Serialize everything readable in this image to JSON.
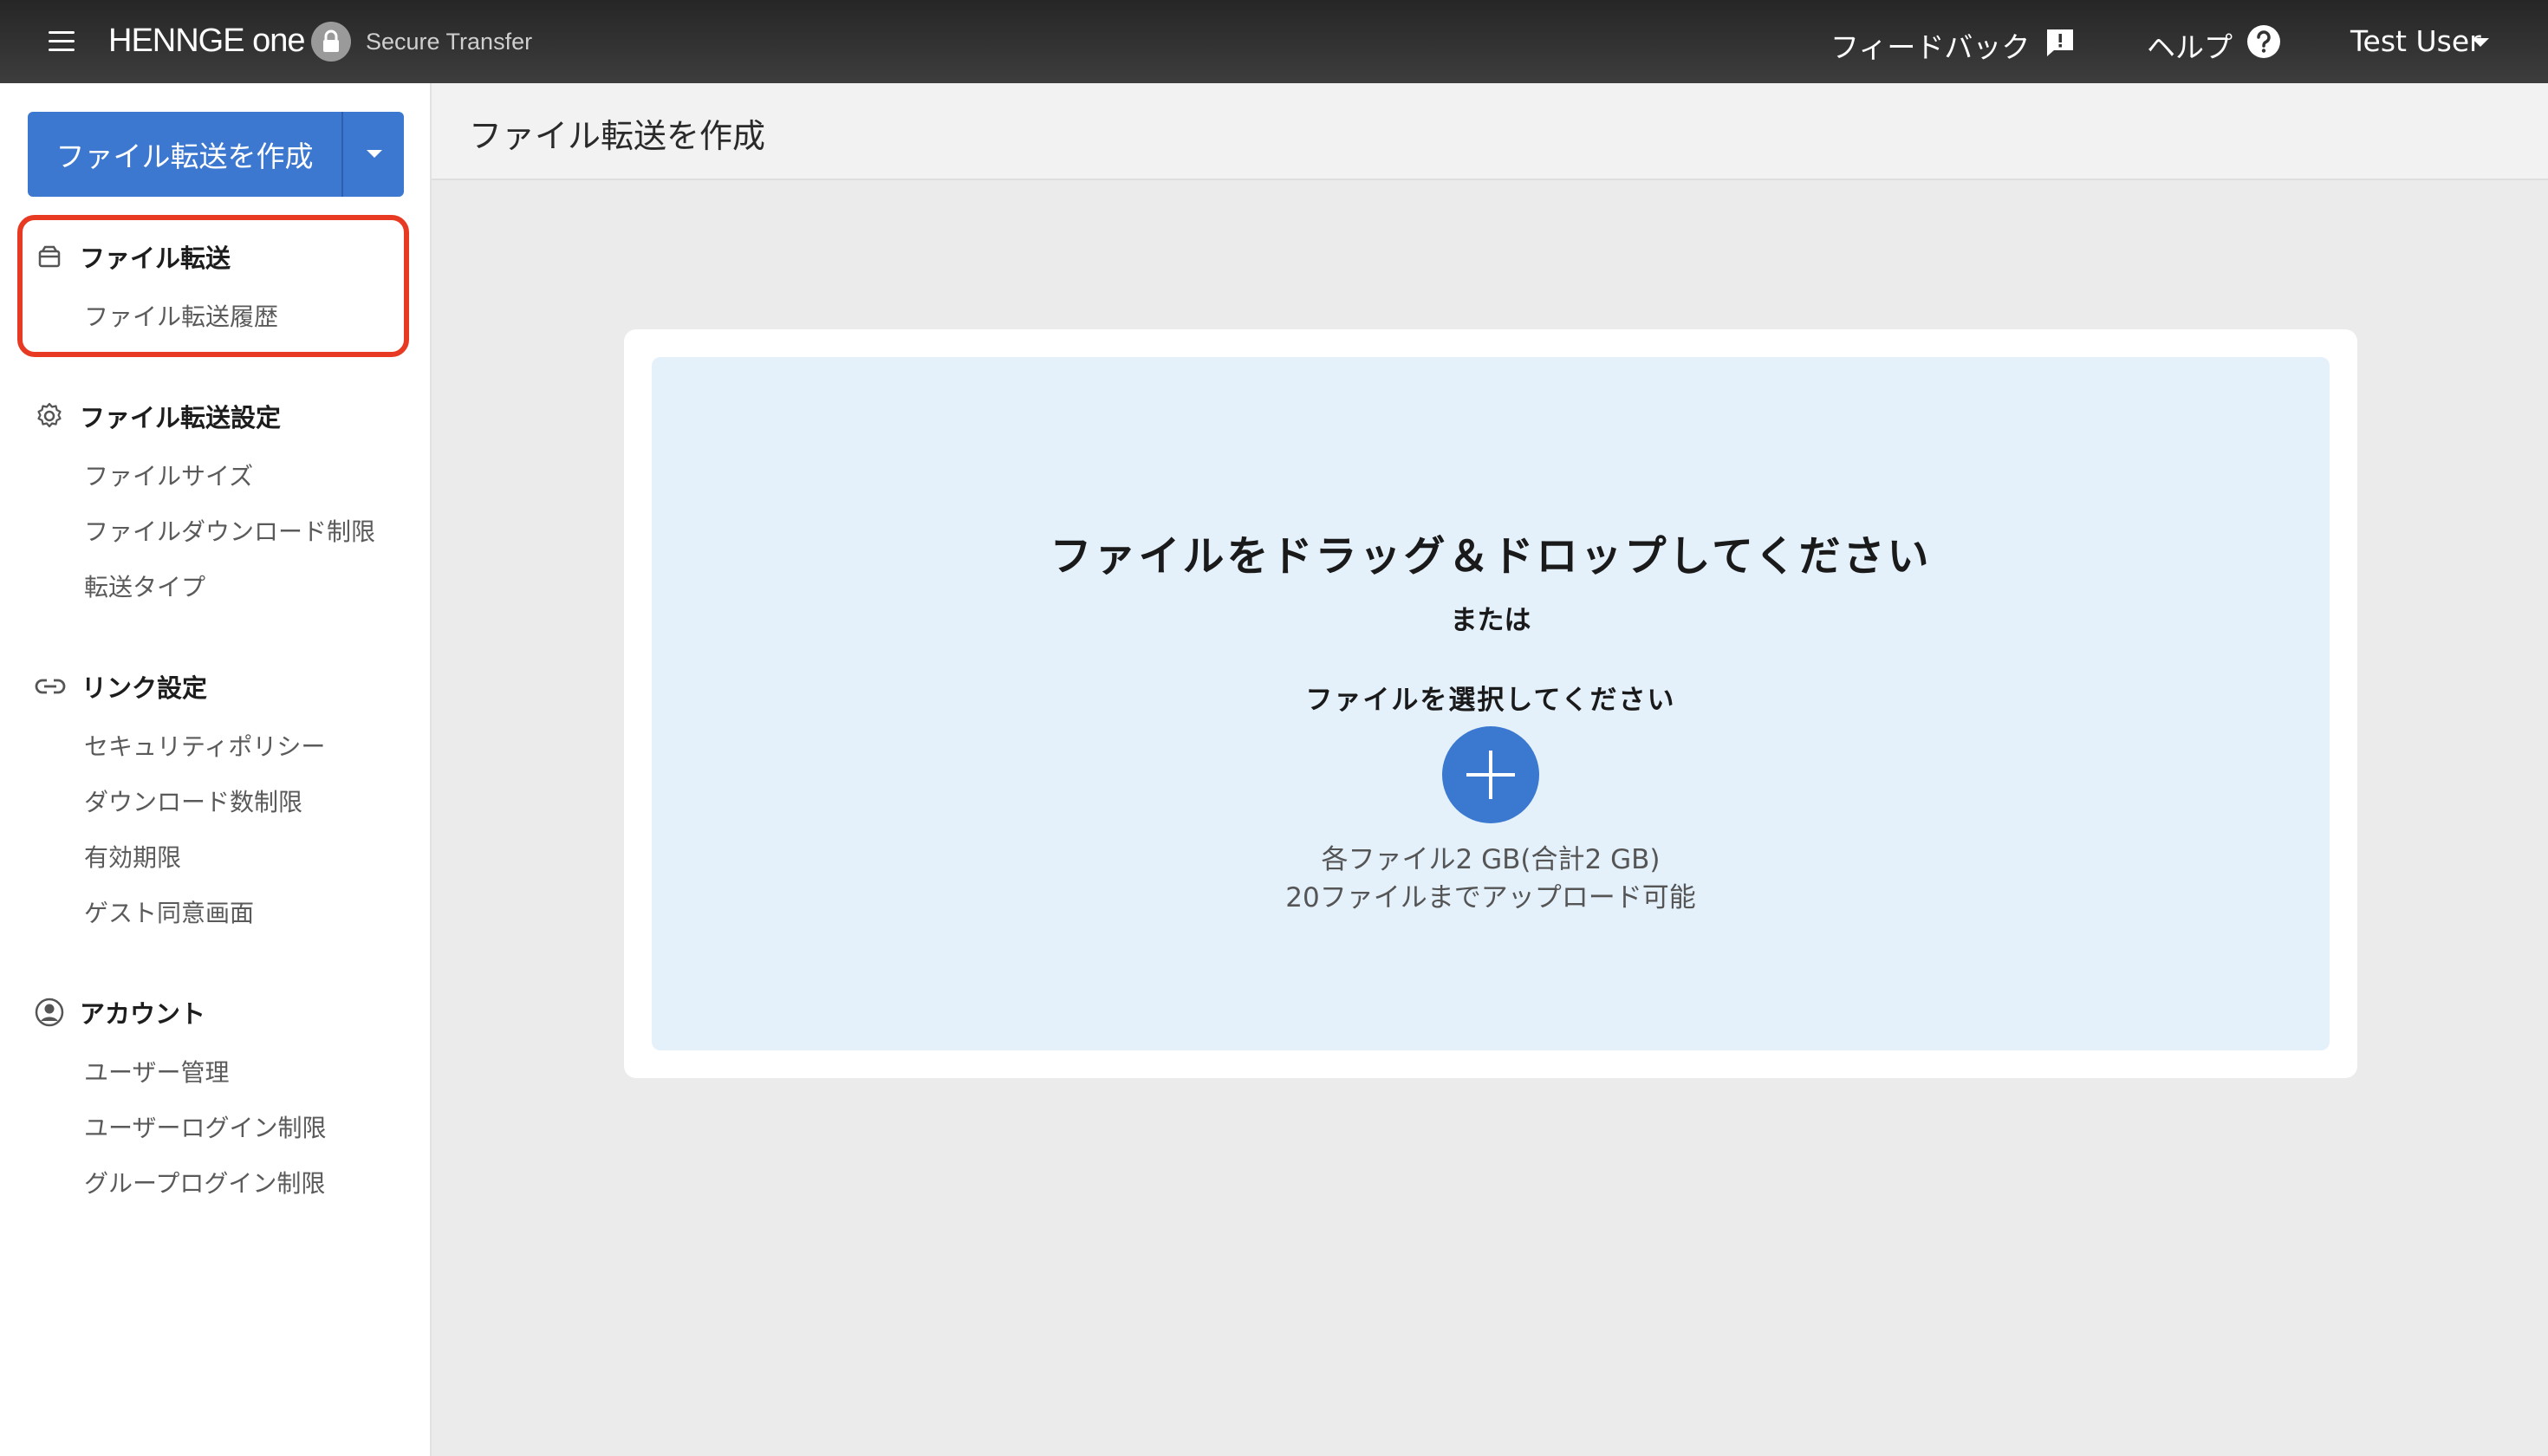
{
  "header": {
    "brand": "HENNGE one",
    "product": "Secure Transfer",
    "feedback_label": "フィードバック",
    "help_label": "ヘルプ",
    "user_name": "Test User"
  },
  "sidebar": {
    "create_button_label": "ファイル転送を作成",
    "sections": [
      {
        "title": "ファイル転送",
        "icon": "archive-box-icon",
        "items": [
          "ファイル転送履歴"
        ]
      },
      {
        "title": "ファイル転送設定",
        "icon": "gear-icon",
        "items": [
          "ファイルサイズ",
          "ファイルダウンロード制限",
          "転送タイプ"
        ]
      },
      {
        "title": "リンク設定",
        "icon": "link-icon",
        "items": [
          "セキュリティポリシー",
          "ダウンロード数制限",
          "有効期限",
          "ゲスト同意画面"
        ]
      },
      {
        "title": "アカウント",
        "icon": "account-circle-icon",
        "items": [
          "ユーザー管理",
          "ユーザーログイン制限",
          "グループログイン制限"
        ]
      }
    ]
  },
  "main": {
    "page_title": "ファイル転送を作成",
    "dropzone": {
      "title": "ファイルをドラッグ＆ドロップしてください",
      "or_text": "または",
      "select_text": "ファイルを選択してください",
      "limit_line1": "各ファイル2 GB(合計2 GB)",
      "limit_line2": "20ファイルまでアップロード可能"
    }
  },
  "colors": {
    "accent": "#3d78d0",
    "highlight": "#e83a22",
    "dropzone_bg": "#e4f1fb",
    "topbar": "#333333"
  }
}
